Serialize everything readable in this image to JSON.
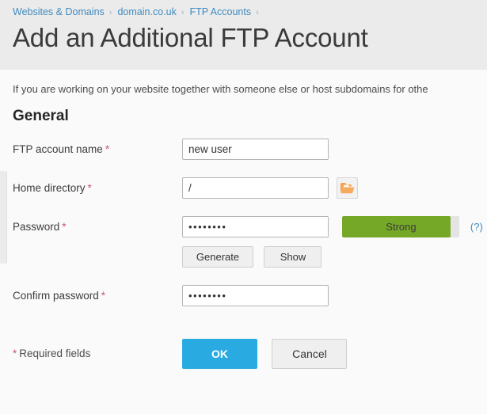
{
  "breadcrumb": {
    "items": [
      {
        "label": "Websites & Domains"
      },
      {
        "label": "domain.co.uk"
      },
      {
        "label": "FTP Accounts"
      }
    ],
    "separator": "›"
  },
  "header": {
    "title": "Add an Additional FTP Account"
  },
  "intro": {
    "text": "If you are working on your website together with someone else or host subdomains for othe"
  },
  "section": {
    "title": "General"
  },
  "fields": {
    "account_name": {
      "label": "FTP account name",
      "required_mark": "*",
      "value": "new user",
      "placeholder": ""
    },
    "home_directory": {
      "label": "Home directory",
      "required_mark": "*",
      "value": "/",
      "placeholder": "",
      "browse_icon": "folder-open-icon"
    },
    "password": {
      "label": "Password",
      "required_mark": "*",
      "value": "••••••••",
      "placeholder": "",
      "strength_label": "Strong",
      "strength_percent": 92,
      "strength_color": "#76a828",
      "help_label": "(?)"
    },
    "confirm_password": {
      "label": "Confirm password",
      "required_mark": "*",
      "value": "••••••••",
      "placeholder": ""
    }
  },
  "password_actions": {
    "generate_label": "Generate",
    "show_label": "Show"
  },
  "footer": {
    "required_star": "*",
    "required_note": "Required fields",
    "ok_label": "OK",
    "cancel_label": "Cancel"
  },
  "colors": {
    "accent_blue": "#29abe2",
    "link_blue": "#3f8bbf",
    "required_red": "#c8586c",
    "strength_green": "#76a828",
    "header_gray": "#ebebeb",
    "folder_orange": "#f5a04b"
  }
}
